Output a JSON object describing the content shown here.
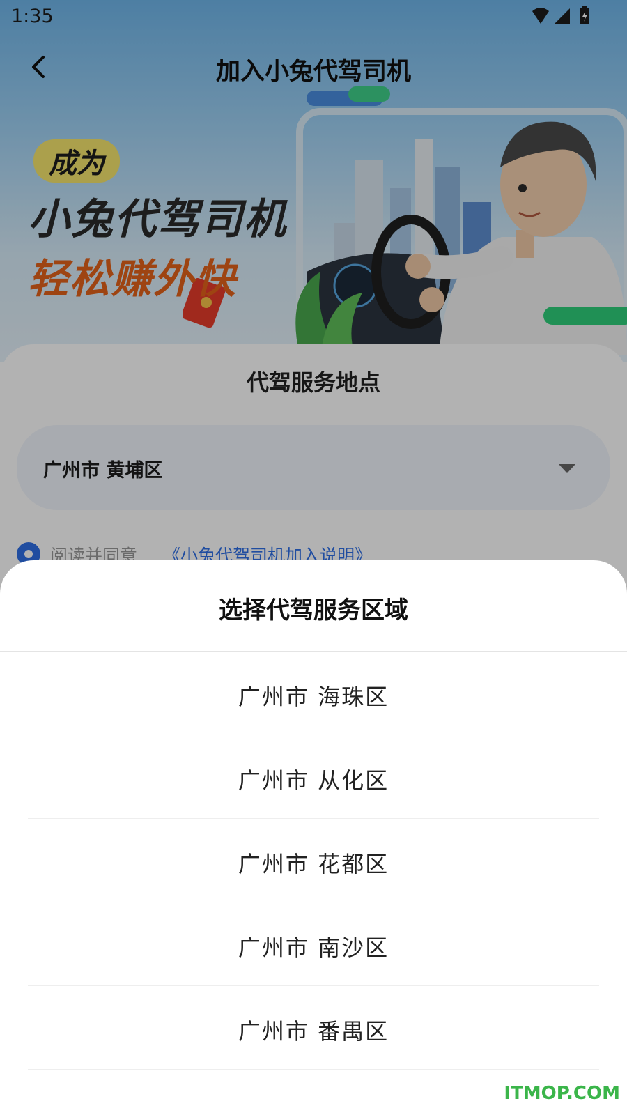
{
  "status_bar": {
    "time": "1:35"
  },
  "nav": {
    "title": "加入小兔代驾司机"
  },
  "banner": {
    "tag": "成为",
    "line1": "小兔代驾司机",
    "line2": "轻松赚外快"
  },
  "form": {
    "section_title": "代驾服务地点",
    "location_value": "广州市 黄埔区",
    "agree_text": "阅读并同意",
    "agree_link": "《小兔代驾司机加入说明》"
  },
  "sheet": {
    "title": "选择代驾服务区域",
    "options": [
      {
        "label": "广州市 海珠区"
      },
      {
        "label": "广州市 从化区"
      },
      {
        "label": "广州市 花都区"
      },
      {
        "label": "广州市 南沙区"
      },
      {
        "label": "广州市 番禺区"
      }
    ]
  },
  "watermark": "ITMOP.COM",
  "colors": {
    "accent_blue": "#2f6fe6",
    "promo_orange": "#e2621a",
    "promo_yellow": "#f5e66d",
    "watermark_green": "#3bb54a"
  }
}
